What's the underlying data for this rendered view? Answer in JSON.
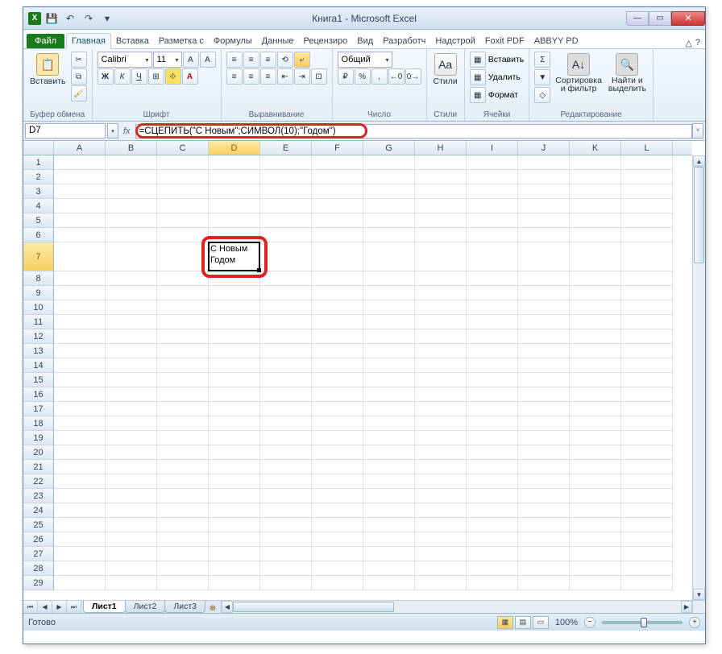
{
  "title": "Книга1 - Microsoft Excel",
  "qat": {
    "excel": "X",
    "save": "💾",
    "undo": "↶",
    "redo": "↷",
    "drop": "▾"
  },
  "wincontrols": {
    "min": "—",
    "max": "▭",
    "close": "✕"
  },
  "ribbon": {
    "file": "Файл",
    "tabs": [
      "Главная",
      "Вставка",
      "Разметка с",
      "Формулы",
      "Данные",
      "Рецензиро",
      "Вид",
      "Разработч",
      "Надстрой",
      "Foxit PDF",
      "ABBYY PD"
    ],
    "help": "?",
    "min": "△"
  },
  "groups": {
    "clipboard": {
      "label": "Буфер обмена",
      "paste": "Вставить",
      "cut": "✂",
      "copy": "⧉",
      "brush": "🖌"
    },
    "font": {
      "label": "Шрифт",
      "name": "Calibri",
      "size": "11",
      "bold": "Ж",
      "italic": "К",
      "underline": "Ч",
      "border": "⊞",
      "fill": "⟐",
      "color": "A",
      "grow": "A",
      "shrink": "A"
    },
    "align": {
      "label": "Выравнивание",
      "tl": "≡",
      "tc": "≡",
      "tr": "≡",
      "ml": "≡",
      "mc": "≡",
      "mr": "≡",
      "wrap": "⤶",
      "merge": "⊡",
      "il": "⇤",
      "ir": "⇥",
      "rot": "⟲"
    },
    "number": {
      "label": "Число",
      "format": "Общий",
      "cur": "₽",
      "pct": "%",
      "comma": ",",
      "dec1": "←0",
      "dec2": "0→"
    },
    "styles": {
      "label": "Стили",
      "btn": "Стили"
    },
    "cells": {
      "label": "Ячейки",
      "insert": "Вставить",
      "delete": "Удалить",
      "format": "Формат",
      "ii": "▦",
      "di": "▦",
      "fi": "▦"
    },
    "editing": {
      "label": "Редактирование",
      "sum": "Σ",
      "fill": "▼",
      "clear": "◇",
      "sort": "Сортировка\nи фильтр",
      "find": "Найти и\nвыделить",
      "sorti": "A↓",
      "findi": "🔍"
    }
  },
  "formulabar": {
    "namebox": "D7",
    "fx": "fx",
    "formula": "=СЦЕПИТЬ(\"С Новым\";СИМВОЛ(10);\"Годом\")",
    "expand": "˅"
  },
  "columns": [
    "A",
    "B",
    "C",
    "D",
    "E",
    "F",
    "G",
    "H",
    "I",
    "J",
    "K",
    "L"
  ],
  "rows": [
    1,
    2,
    3,
    4,
    5,
    6,
    7,
    8,
    9,
    10,
    11,
    12,
    13,
    14,
    15,
    16,
    17,
    18,
    19,
    20,
    21,
    22,
    23,
    24,
    25,
    26,
    27,
    28,
    29
  ],
  "activeCell": "D7",
  "cellD7": "С Новым\nГодом",
  "sheets": {
    "nav": [
      "⏮",
      "◀",
      "▶",
      "⏭"
    ],
    "tabs": [
      "Лист1",
      "Лист2",
      "Лист3"
    ],
    "active": 0,
    "ins": "⊕"
  },
  "status": {
    "ready": "Готово",
    "zoom": "100%",
    "minus": "−",
    "plus": "+"
  }
}
